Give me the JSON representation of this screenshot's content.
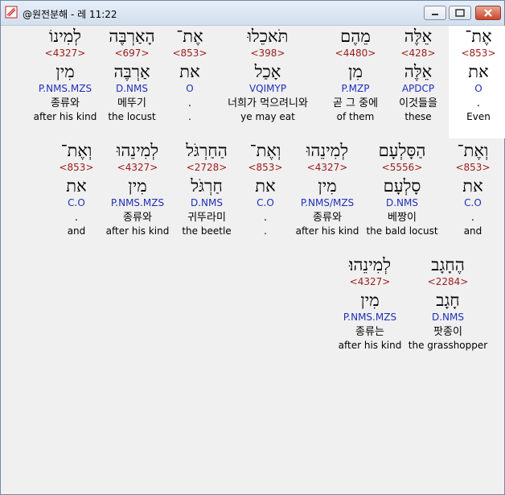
{
  "window": {
    "title": "@원전분해 - 레 11:22"
  },
  "rows": [
    [
      {
        "heb": "אֶת־",
        "strong": "<853>",
        "lex": "את",
        "parse": "O",
        "kor": ".",
        "eng": "Even"
      },
      {
        "heb": "אֵלֶּה",
        "strong": "<428>",
        "lex": "אֵלֶּה",
        "parse": "APDCP",
        "kor": "이것들을",
        "eng": "these"
      },
      {
        "heb": "מֵהֶם",
        "strong": "<4480>",
        "lex": "מִן",
        "parse": "P.MZP",
        "kor": "곧 그 중에",
        "eng": "of them"
      },
      {
        "heb": "תֹּאכֵלוּ",
        "strong": "<398>",
        "lex": "אָכַל",
        "parse": "VQIMYP",
        "kor": "너희가 먹으려니와",
        "eng": "ye may eat"
      },
      {
        "heb": "אֶת־",
        "strong": "<853>",
        "lex": "את",
        "parse": "O",
        "kor": ".",
        "eng": "."
      },
      {
        "heb": "הָאַרְבֶּה",
        "strong": "<697>",
        "lex": "אַרְבֶּה",
        "parse": "D.NMS",
        "kor": "메뚜기",
        "eng": "the locust"
      },
      {
        "heb": "לְמִינוֹ",
        "strong": "<4327>",
        "lex": "מִין",
        "parse": "P.NMS.MZS",
        "kor": "종류와",
        "eng": "after his kind"
      }
    ],
    [
      {
        "heb": "וְאֶת־",
        "strong": "<853>",
        "lex": "את",
        "parse": "C.O",
        "kor": ".",
        "eng": "and"
      },
      {
        "heb": "הַסָּלְעָם",
        "strong": "<5556>",
        "lex": "סָלְעָם",
        "parse": "D.NMS",
        "kor": "베짱이",
        "eng": "the bald locust"
      },
      {
        "heb": "לְמִינֵהוּ",
        "strong": "<4327>",
        "lex": "מִין",
        "parse": "P.NMS/MZS",
        "kor": "종류와",
        "eng": "after his kind"
      },
      {
        "heb": "וְאֶת־",
        "strong": "<853>",
        "lex": "את",
        "parse": "C.O",
        "kor": ".",
        "eng": "."
      },
      {
        "heb": "הַחַרְגֹּל",
        "strong": "<2728>",
        "lex": "חַרְגֹּל",
        "parse": "D.NMS",
        "kor": "귀뚜라미",
        "eng": "the beetle"
      },
      {
        "heb": "לְמִינֵהוּ",
        "strong": "<4327>",
        "lex": "מִין",
        "parse": "P.NMS.MZS",
        "kor": "종류와",
        "eng": "after his kind"
      },
      {
        "heb": "וְאֶת־",
        "strong": "<853>",
        "lex": "את",
        "parse": "C.O",
        "kor": ".",
        "eng": "and"
      }
    ],
    [
      {
        "heb": "הֶחָגָב",
        "strong": "<2284>",
        "lex": "חָגָב",
        "parse": "D.NMS",
        "kor": "팟종이",
        "eng": "the grasshopper"
      },
      {
        "heb": "לְמִינֵהוּ׃",
        "strong": "<4327>",
        "lex": "מִין",
        "parse": "P.NMS.MZS",
        "kor": "종류는",
        "eng": "after his kind"
      }
    ]
  ]
}
